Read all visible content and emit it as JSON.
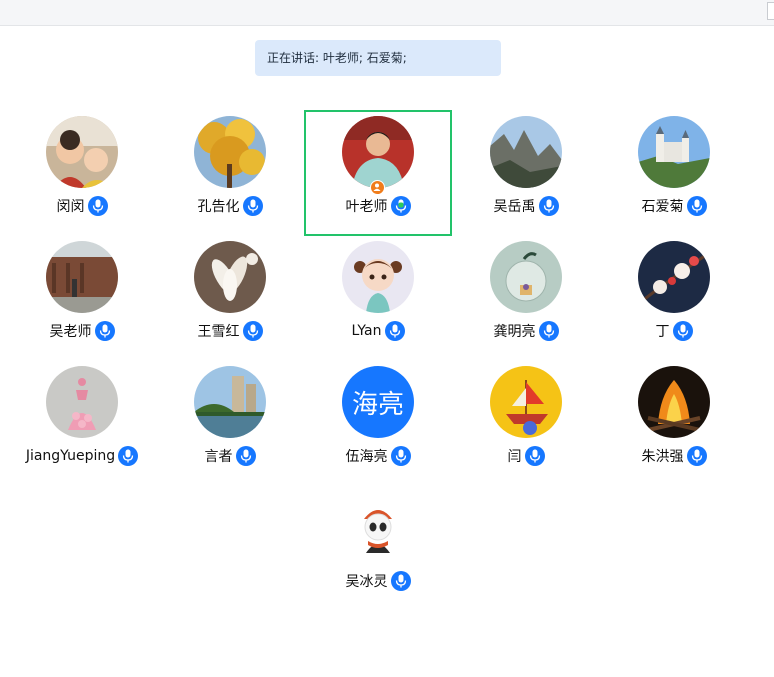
{
  "banner": {
    "text": "正在讲话: 叶老师; 石爱菊;"
  },
  "colors": {
    "accent": "#1677ff",
    "active_border": "#22c36a",
    "speaking_mic": "#2ecc5a",
    "host_badge": "#f07c1b",
    "banner_bg": "#dbe9fb"
  },
  "participants": [
    {
      "name": "闵闵",
      "avatar_icon": "kids-photo-avatar",
      "mic": "unmuted",
      "speaking": false,
      "host": false
    },
    {
      "name": "孔告化",
      "avatar_icon": "yellow-tree-avatar",
      "mic": "unmuted",
      "speaking": false,
      "host": false
    },
    {
      "name": "叶老师",
      "avatar_icon": "teacher-photo-avatar",
      "mic": "speaking",
      "speaking": true,
      "host": true
    },
    {
      "name": "吴岳禹",
      "avatar_icon": "mountain-avatar",
      "mic": "unmuted",
      "speaking": false,
      "host": false
    },
    {
      "name": "石爱菊",
      "avatar_icon": "castle-avatar",
      "mic": "speaking",
      "speaking": true,
      "host": false
    },
    {
      "name": "吴老师",
      "avatar_icon": "street-wall-avatar",
      "mic": "unmuted",
      "speaking": false,
      "host": false
    },
    {
      "name": "王雪红",
      "avatar_icon": "magnolia-avatar",
      "mic": "unmuted",
      "speaking": false,
      "host": false
    },
    {
      "name": "LYan",
      "avatar_icon": "cartoon-girl-avatar",
      "mic": "unmuted",
      "speaking": false,
      "host": false
    },
    {
      "name": "龚明亮",
      "avatar_icon": "glass-apple-avatar",
      "mic": "unmuted",
      "speaking": false,
      "host": false
    },
    {
      "name": "丁",
      "avatar_icon": "plum-blossom-avatar",
      "mic": "unmuted",
      "speaking": false,
      "host": false
    },
    {
      "name": "JiangYueping",
      "avatar_icon": "flower-dress-avatar",
      "mic": "unmuted",
      "speaking": false,
      "host": false
    },
    {
      "name": "言者",
      "avatar_icon": "lake-buildings-avatar",
      "mic": "unmuted",
      "speaking": false,
      "host": false
    },
    {
      "name": "伍海亮",
      "avatar_icon": "text-avatar",
      "avatar_text": "海亮",
      "mic": "unmuted",
      "speaking": false,
      "host": false
    },
    {
      "name": "闫",
      "avatar_icon": "lucky-boat-avatar",
      "mic": "unmuted",
      "speaking": false,
      "host": false
    },
    {
      "name": "朱洪强",
      "avatar_icon": "bonfire-avatar",
      "mic": "unmuted",
      "speaking": false,
      "host": false
    },
    {
      "name": "吴冰灵",
      "avatar_icon": "panda-avatar",
      "mic": "unmuted",
      "speaking": false,
      "host": false
    }
  ]
}
